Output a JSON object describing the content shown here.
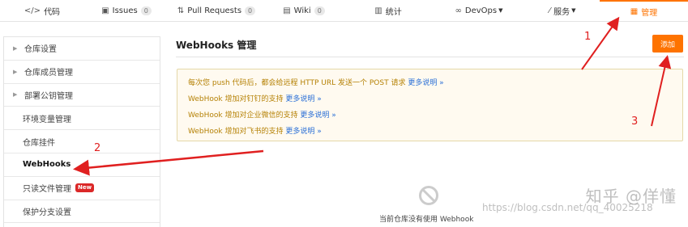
{
  "topnav": {
    "tabs": [
      {
        "icon": "</>",
        "label": "代码",
        "count": ""
      },
      {
        "icon": "▣",
        "label": "Issues",
        "count": "0"
      },
      {
        "icon": "⇅",
        "label": "Pull Requests",
        "count": "0"
      },
      {
        "icon": "▤",
        "label": "Wiki",
        "count": "0"
      },
      {
        "icon": "▥",
        "label": "统计",
        "count": ""
      },
      {
        "icon": "∞",
        "label": "DevOps",
        "count": ""
      },
      {
        "icon": "⁄",
        "label": "服务",
        "count": ""
      },
      {
        "icon": "▦",
        "label": "管理",
        "count": ""
      }
    ]
  },
  "sidebar": {
    "items": [
      {
        "label": "仓库设置"
      },
      {
        "label": "仓库成员管理"
      },
      {
        "label": "部署公钥管理"
      },
      {
        "label": "环境变量管理"
      },
      {
        "label": "仓库挂件"
      },
      {
        "label": "WebHooks"
      },
      {
        "label": "只读文件管理",
        "badge": "New"
      },
      {
        "label": "保护分支设置"
      }
    ]
  },
  "main": {
    "title": "WebHooks 管理",
    "add_button": "添加",
    "notice": {
      "lines": [
        {
          "text": "每次您 push 代码后，都会给远程 HTTP URL 发送一个 POST 请求 ",
          "link": "更多说明 »"
        },
        {
          "text": "WebHook 增加对钉钉的支持 ",
          "link": "更多说明 »"
        },
        {
          "text": "WebHook 增加对企业微信的支持 ",
          "link": "更多说明 »"
        },
        {
          "text": "WebHook 增加对飞书的支持 ",
          "link": "更多说明 »"
        }
      ]
    },
    "empty_text": "当前仓库没有使用 Webhook"
  },
  "annotations": {
    "one": "1",
    "two": "2",
    "three": "3"
  },
  "watermark": {
    "text": "知乎 @佯懂",
    "url": "https://blog.csdn.net/qq_40025218"
  },
  "colors": {
    "accent": "#fe7300",
    "annotation": "#e02020",
    "link": "#2a6fd6",
    "notice_text": "#b58105"
  }
}
